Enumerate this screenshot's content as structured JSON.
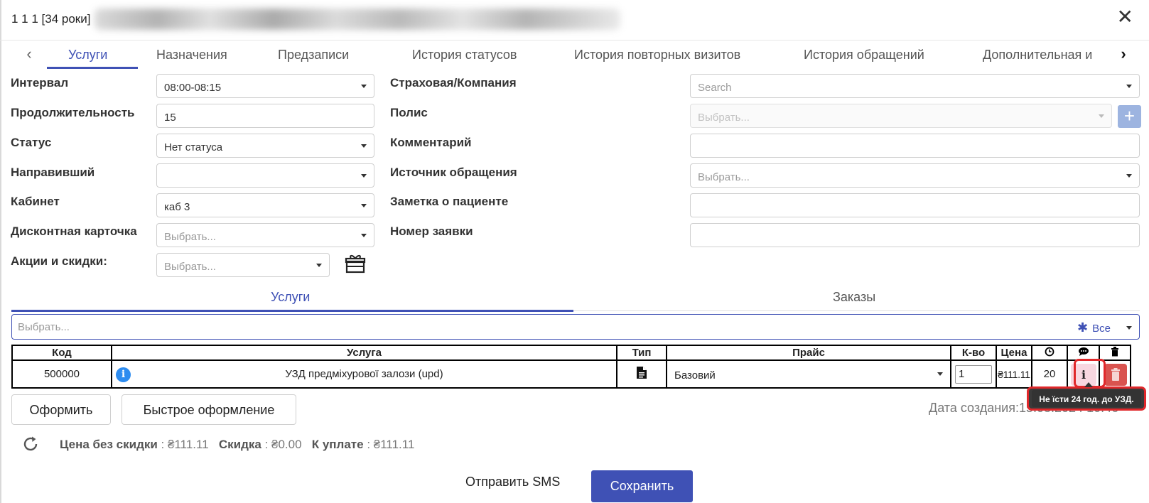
{
  "window": {
    "title": "1 1 1 [34 роки]",
    "close_icon": "close-icon"
  },
  "tabs": [
    {
      "label": "Услуги",
      "active": true
    },
    {
      "label": "Назначения"
    },
    {
      "label": "Предзаписи"
    },
    {
      "label": "История статусов"
    },
    {
      "label": "История повторных визитов"
    },
    {
      "label": "История обращений"
    },
    {
      "label": "Дополнительная и"
    }
  ],
  "form": {
    "interval": {
      "label": "Интервал",
      "value": "08:00-08:15"
    },
    "duration": {
      "label": "Продолжительность",
      "value": "15"
    },
    "status": {
      "label": "Статус",
      "value": "Нет статуса"
    },
    "referrer": {
      "label": "Направивший",
      "value": ""
    },
    "cabinet": {
      "label": "Кабинет",
      "value": "каб 3"
    },
    "discount_card": {
      "label": "Дисконтная карточка",
      "placeholder": "Выбрать..."
    },
    "promotions": {
      "label": "Акции и скидки:",
      "placeholder": "Выбрать..."
    },
    "insurance": {
      "label": "Страховая/Компания",
      "placeholder": "Search"
    },
    "policy": {
      "label": "Полис",
      "placeholder": "Выбрать..."
    },
    "comment": {
      "label": "Комментарий",
      "value": ""
    },
    "source": {
      "label": "Источник обращения",
      "placeholder": "Выбрать..."
    },
    "patient_note": {
      "label": "Заметка о пациенте",
      "value": ""
    },
    "request_number": {
      "label": "Номер заявки",
      "value": ""
    }
  },
  "inner_tabs": [
    {
      "label": "Услуги",
      "active": true
    },
    {
      "label": "Заказы"
    }
  ],
  "service_search": {
    "placeholder": "Выбрать...",
    "filter_label": "Все"
  },
  "table": {
    "headers": {
      "code": "Код",
      "service": "Услуга",
      "type": "Тип",
      "price_list": "Прайс",
      "qty": "К-во",
      "price": "Цена"
    },
    "rows": [
      {
        "code": "500000",
        "service": "УЗД предміхурової залози (upd)",
        "price_list": "Базовий",
        "qty": "1",
        "price": "₴111.11",
        "duration": "20",
        "note_icon": "i"
      }
    ]
  },
  "tooltip": "Не їсти 24 год. до УЗД.",
  "actions": {
    "checkout": "Оформить",
    "quick_checkout": "Быстрое оформление",
    "send_sms": "Отправить SMS",
    "save": "Сохранить"
  },
  "created": {
    "label": "Дата создания:",
    "value": "15.03.2024 10:46"
  },
  "summary": {
    "price_label": "Цена без скидки",
    "price_value": "₴111.11",
    "discount_label": "Скидка",
    "discount_value": "₴0.00",
    "pay_label": "К уплате",
    "pay_value": "₴111.11",
    "separator": " : "
  },
  "colors": {
    "accent": "#3f51b5",
    "danger": "#d9534f",
    "highlight": "#e0282b",
    "info": "#2d8cf0"
  }
}
